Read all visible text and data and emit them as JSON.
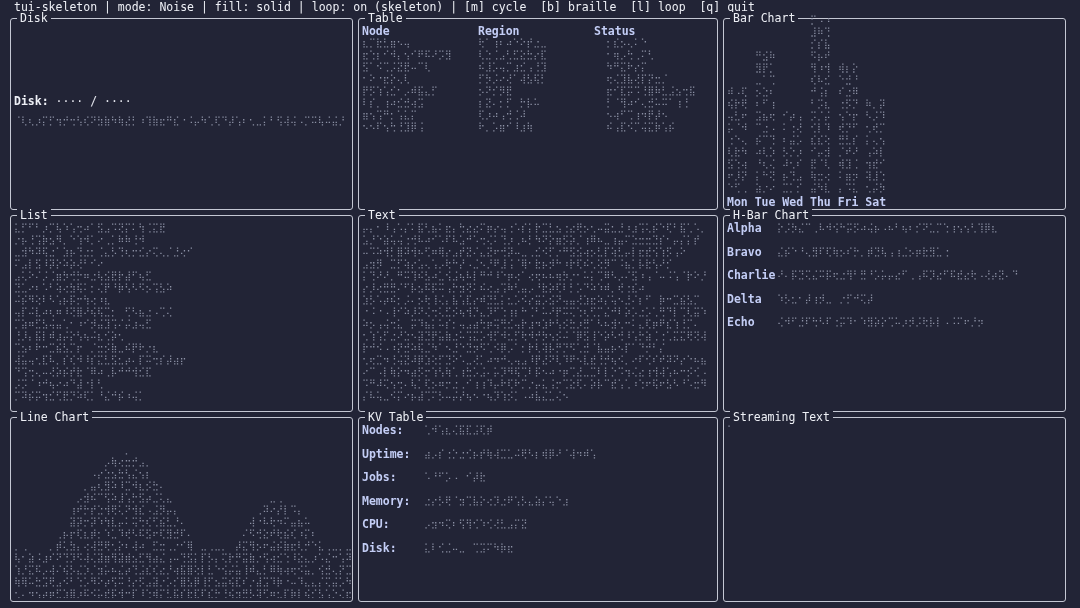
{
  "header": "tui-skeleton | mode: Noise | fill: solid | loop: on (skeleton) | [m] cycle  [b] braille  [l] loop  [q] quit",
  "panels": [
    {
      "kind": "gauge",
      "title": "Disk",
      "label": "**Disk:** ···· / ····"
    },
    {
      "kind": "table",
      "title": "Table",
      "columns": [
        "Node",
        "Region",
        "Status"
      ]
    },
    {
      "kind": "bars",
      "title": "Bar Chart",
      "categories": [
        "Mon",
        "Tue",
        "Wed",
        "Thu",
        "Fri",
        "Sat"
      ]
    },
    {
      "kind": "list",
      "title": "List"
    },
    {
      "kind": "text",
      "title": "Text"
    },
    {
      "kind": "hbars",
      "title": "H-Bar Chart",
      "labels": [
        "Alpha",
        "Bravo",
        "Charlie",
        "Delta",
        "Echo"
      ]
    },
    {
      "kind": "line",
      "title": "Line Chart"
    },
    {
      "kind": "kv",
      "title": "KV Table",
      "keys": [
        "Nodes:",
        "Uptime:",
        "Jobs:",
        "Memory:",
        "CPU:",
        "Disk:"
      ]
    },
    {
      "kind": "stream",
      "title": "Streaming Text"
    }
  ]
}
